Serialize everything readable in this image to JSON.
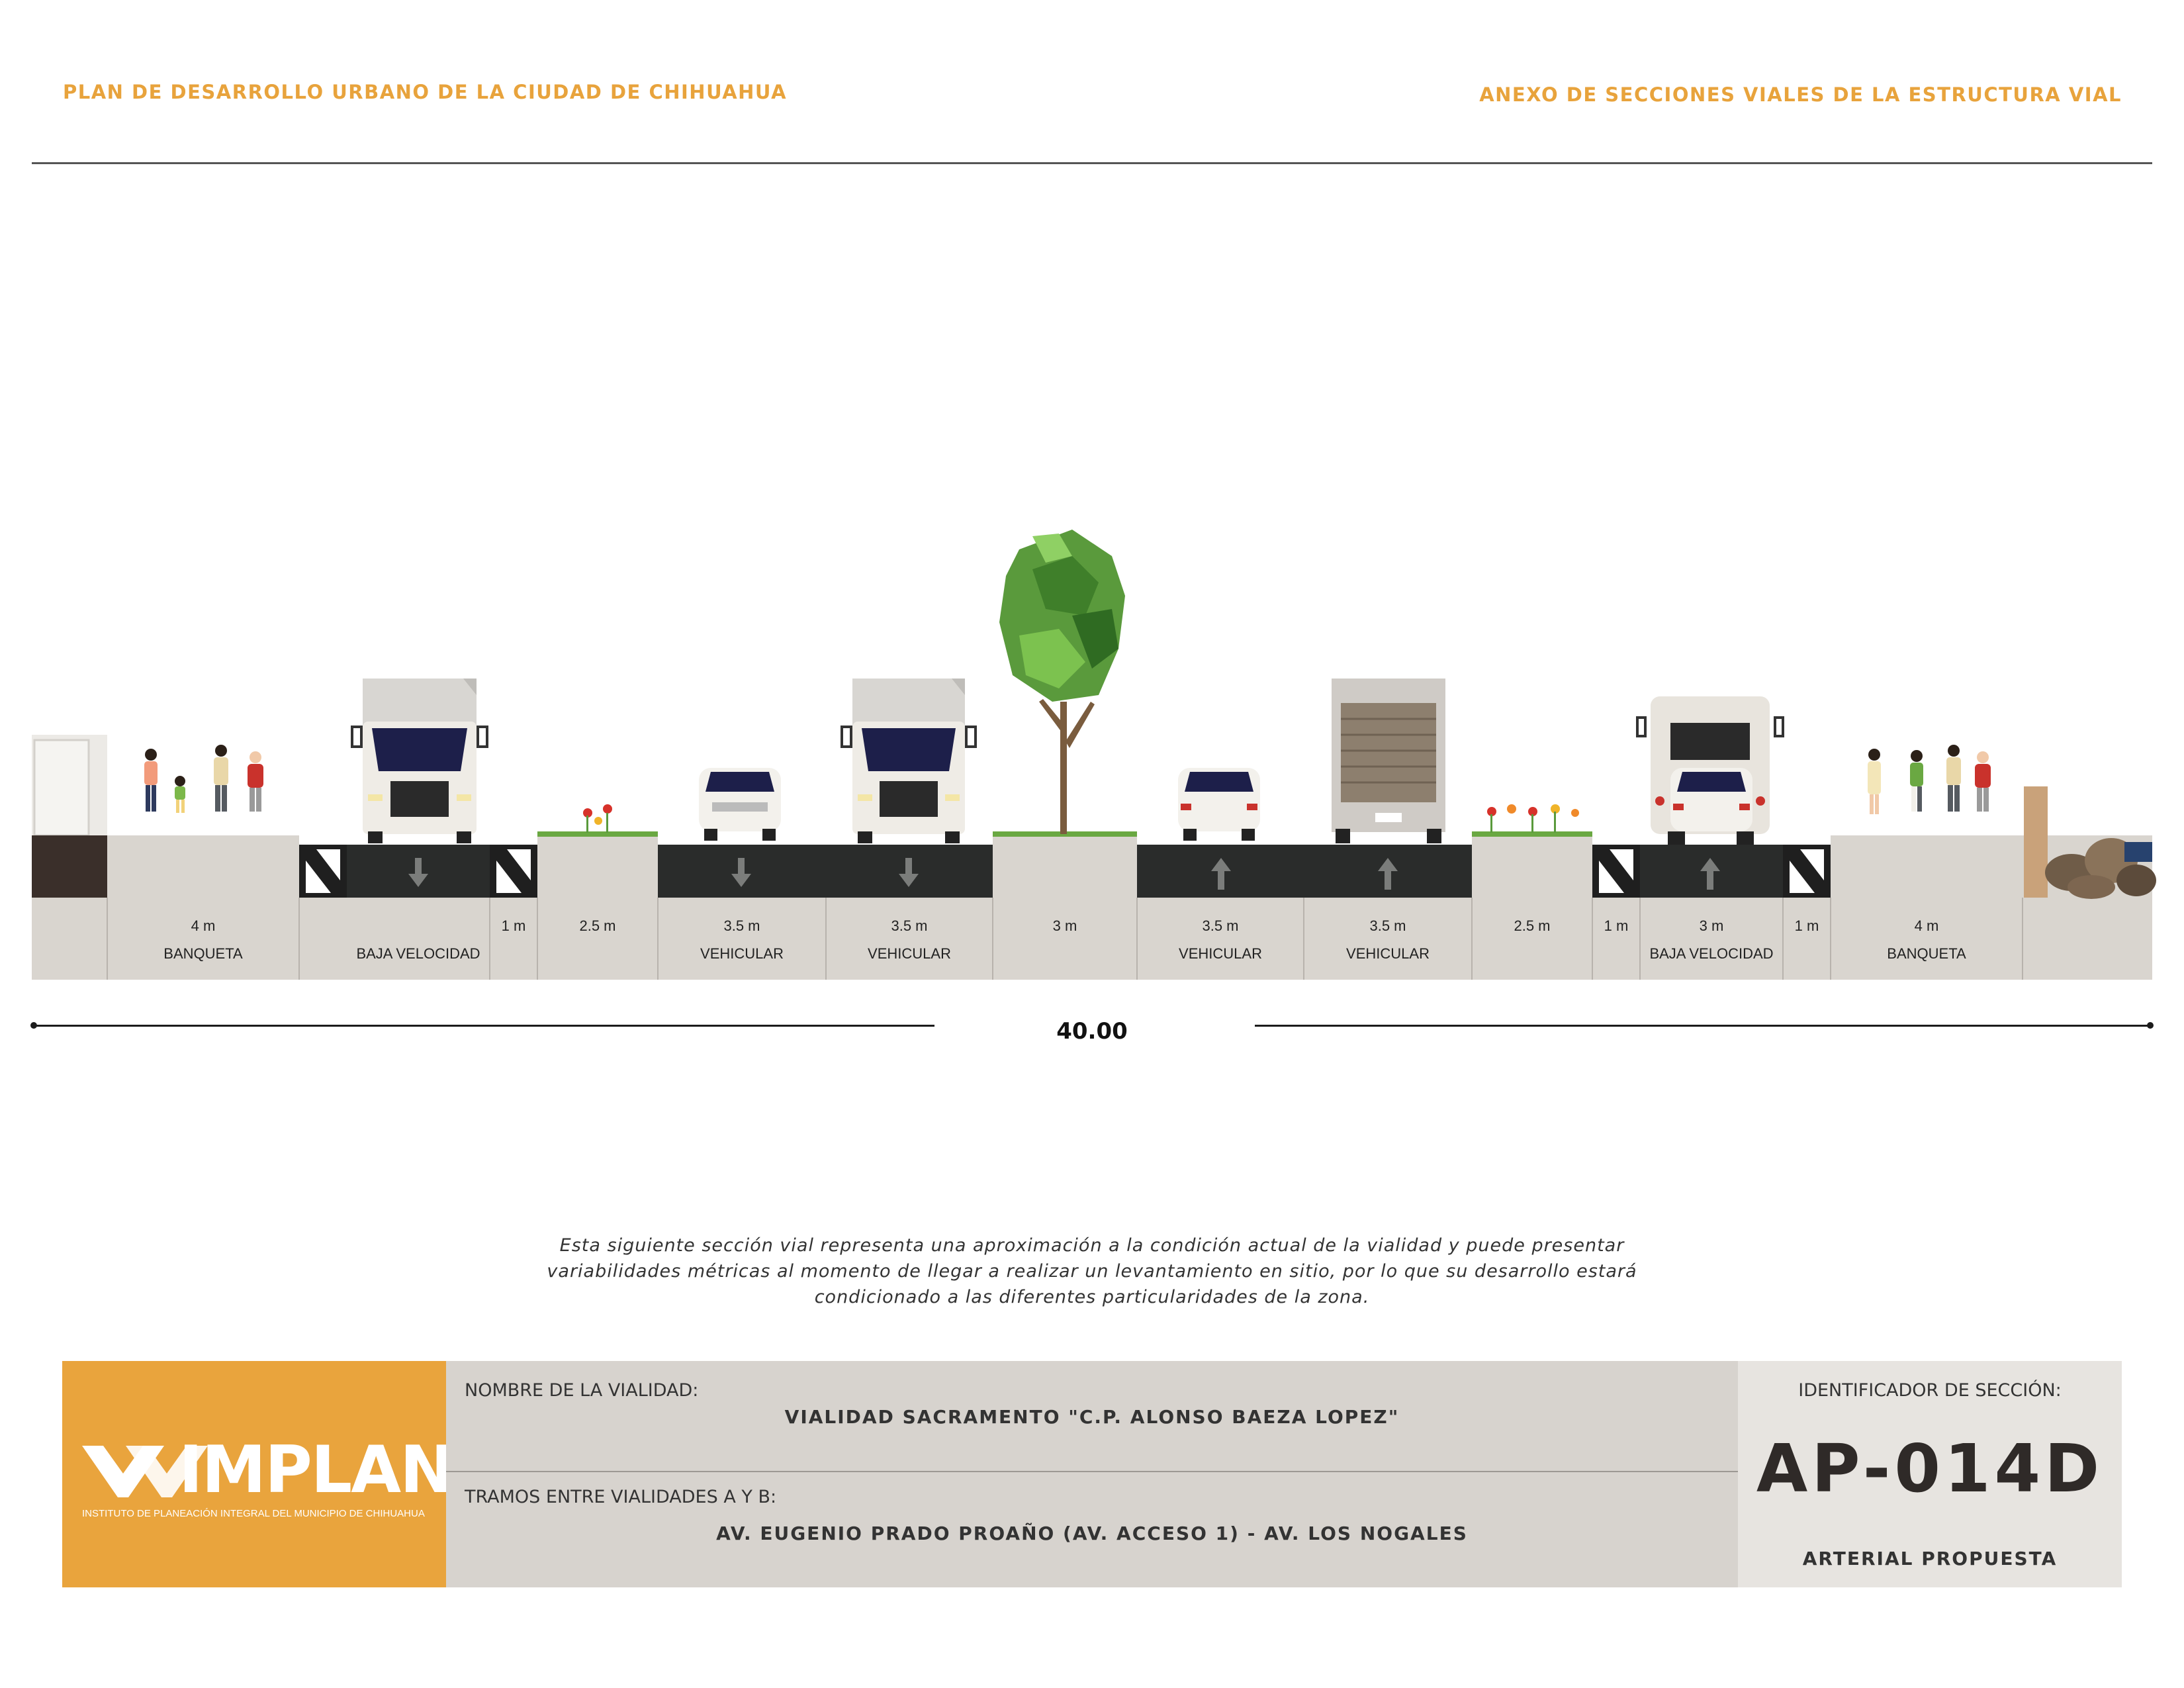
{
  "header": {
    "left_title": "PLAN DE DESARROLLO URBANO DE LA CIUDAD DE CHIHUAHUA",
    "right_title": "ANEXO DE SECCIONES VIALES DE LA ESTRUCTURA VIAL"
  },
  "section": {
    "segments": [
      {
        "width": "4 m",
        "label": "BANQUETA"
      },
      {
        "width": "",
        "label": "BAJA VELOCIDAD"
      },
      {
        "width": "1 m",
        "label": ""
      },
      {
        "width": "2.5 m",
        "label": ""
      },
      {
        "width": "3.5 m",
        "label": "VEHICULAR"
      },
      {
        "width": "3.5 m",
        "label": "VEHICULAR"
      },
      {
        "width": "3 m",
        "label": ""
      },
      {
        "width": "3.5 m",
        "label": "VEHICULAR"
      },
      {
        "width": "3.5 m",
        "label": "VEHICULAR"
      },
      {
        "width": "2.5 m",
        "label": ""
      },
      {
        "width": "1 m",
        "label": ""
      },
      {
        "width": "3 m",
        "label": "BAJA VELOCIDAD"
      },
      {
        "width": "1 m",
        "label": ""
      },
      {
        "width": "4 m",
        "label": "BANQUETA"
      }
    ],
    "total_width": "40.00"
  },
  "note": "Esta siguiente sección vial representa una aproximación a la condición actual de la vialidad y puede presentar variabilidades métricas al momento de llegar a realizar un levantamiento en sitio, por lo que su desarrollo estará condicionado a las diferentes particularidades de la zona.",
  "title_block": {
    "logo_text": "IMPLAN",
    "logo_subtitle": "INSTITUTO DE PLANEACIÓN INTEGRAL DEL MUNICIPIO DE CHIHUAHUA",
    "road_name_label": "NOMBRE DE LA VIALIDAD:",
    "road_name": "VIALIDAD SACRAMENTO \"C.P. ALONSO BAEZA LOPEZ\"",
    "stretch_label": "TRAMOS ENTRE VIALIDADES A Y B:",
    "stretch": "AV. EUGENIO PRADO PROAÑO (AV. ACCESO 1) - AV. LOS NOGALES",
    "section_id_label": "IDENTIFICADOR DE SECCIÓN:",
    "section_id": "AP-014D",
    "classification": "ARTERIAL PROPUESTA"
  },
  "colors": {
    "accent": "#e8a33c",
    "asphalt": "#2a2c2b",
    "sidewalk": "#d9d5cf",
    "title_block_mid": "#d7d3ce",
    "tree_green": "#5a9a3c"
  }
}
